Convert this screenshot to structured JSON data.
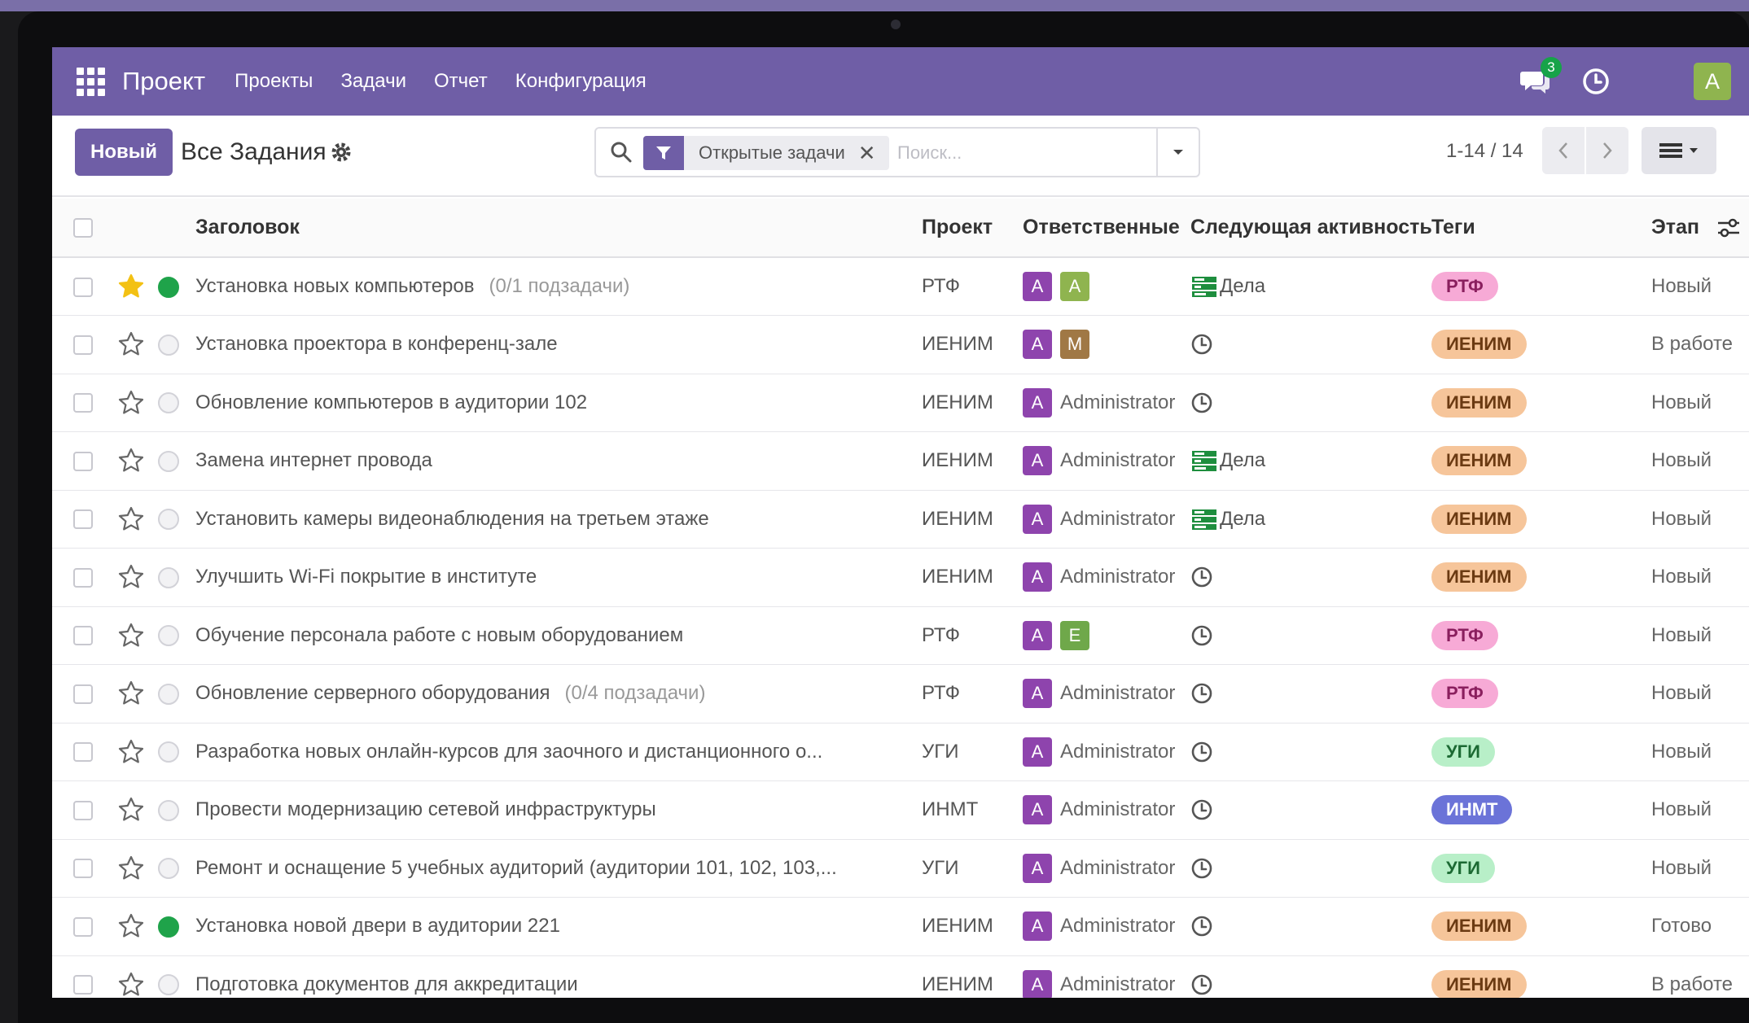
{
  "navbar": {
    "app_name": "Проект",
    "menu": [
      "Проекты",
      "Задачи",
      "Отчет",
      "Конфигурация"
    ],
    "chat_count": "3",
    "user_initial": "A"
  },
  "control": {
    "new_button": "Новый",
    "view_title": "Все Задания",
    "search_facet": "Открытые задачи",
    "search_placeholder": "Поиск...",
    "pager": "1-14 / 14"
  },
  "table": {
    "headers": {
      "title": "Заголовок",
      "project": "Проект",
      "assignees": "Ответственные",
      "activity": "Следующая активность",
      "tags": "Теги",
      "stage": "Этап"
    },
    "rows": [
      {
        "starred": true,
        "done": true,
        "title": "Установка новых компьютеров",
        "subtasks": "(0/1 подзадачи)",
        "project": "РТФ",
        "avatars": [
          {
            "letter": "A",
            "color": "#8e44ad"
          },
          {
            "letter": "A",
            "color": "#8fb44f"
          }
        ],
        "assignee_name": "",
        "activity": "Дела",
        "tag": "РТФ",
        "tag_kind": "rtf",
        "stage": "Новый"
      },
      {
        "starred": false,
        "done": false,
        "title": "Установка проектора в конференц-зале",
        "subtasks": "",
        "project": "ИЕНИМ",
        "avatars": [
          {
            "letter": "A",
            "color": "#8e44ad"
          },
          {
            "letter": "M",
            "color": "#a07845"
          }
        ],
        "assignee_name": "",
        "activity": "",
        "tag": "ИЕНИМ",
        "tag_kind": "ienim",
        "stage": "В работе"
      },
      {
        "starred": false,
        "done": false,
        "title": "Обновление компьютеров в аудитории 102",
        "subtasks": "",
        "project": "ИЕНИМ",
        "avatars": [
          {
            "letter": "A",
            "color": "#8e44ad"
          }
        ],
        "assignee_name": "Administrator",
        "activity": "",
        "tag": "ИЕНИМ",
        "tag_kind": "ienim",
        "stage": "Новый"
      },
      {
        "starred": false,
        "done": false,
        "title": "Замена интернет провода",
        "subtasks": "",
        "project": "ИЕНИМ",
        "avatars": [
          {
            "letter": "A",
            "color": "#8e44ad"
          }
        ],
        "assignee_name": "Administrator",
        "activity": "Дела",
        "tag": "ИЕНИМ",
        "tag_kind": "ienim",
        "stage": "Новый"
      },
      {
        "starred": false,
        "done": false,
        "title": "Установить камеры видеонаблюдения на третьем этаже",
        "subtasks": "",
        "project": "ИЕНИМ",
        "avatars": [
          {
            "letter": "A",
            "color": "#8e44ad"
          }
        ],
        "assignee_name": "Administrator",
        "activity": "Дела",
        "tag": "ИЕНИМ",
        "tag_kind": "ienim",
        "stage": "Новый"
      },
      {
        "starred": false,
        "done": false,
        "title": "Улучшить Wi-Fi покрытие в институте",
        "subtasks": "",
        "project": "ИЕНИМ",
        "avatars": [
          {
            "letter": "A",
            "color": "#8e44ad"
          }
        ],
        "assignee_name": "Administrator",
        "activity": "",
        "tag": "ИЕНИМ",
        "tag_kind": "ienim",
        "stage": "Новый"
      },
      {
        "starred": false,
        "done": false,
        "title": "Обучение персонала работе с новым оборудованием",
        "subtasks": "",
        "project": "РТФ",
        "avatars": [
          {
            "letter": "A",
            "color": "#8e44ad"
          },
          {
            "letter": "E",
            "color": "#6fa84a"
          }
        ],
        "assignee_name": "",
        "activity": "",
        "tag": "РТФ",
        "tag_kind": "rtf",
        "stage": "Новый"
      },
      {
        "starred": false,
        "done": false,
        "title": "Обновление серверного оборудования",
        "subtasks": "(0/4 подзадачи)",
        "project": "РТФ",
        "avatars": [
          {
            "letter": "A",
            "color": "#8e44ad"
          }
        ],
        "assignee_name": "Administrator",
        "activity": "",
        "tag": "РТФ",
        "tag_kind": "rtf",
        "stage": "Новый"
      },
      {
        "starred": false,
        "done": false,
        "title": "Разработка новых онлайн-курсов для заочного и дистанционного о...",
        "subtasks": "",
        "project": "УГИ",
        "avatars": [
          {
            "letter": "A",
            "color": "#8e44ad"
          }
        ],
        "assignee_name": "Administrator",
        "activity": "",
        "tag": "УГИ",
        "tag_kind": "ugi",
        "stage": "Новый"
      },
      {
        "starred": false,
        "done": false,
        "title": "Провести модернизацию сетевой инфраструктуры",
        "subtasks": "",
        "project": "ИНМТ",
        "avatars": [
          {
            "letter": "A",
            "color": "#8e44ad"
          }
        ],
        "assignee_name": "Administrator",
        "activity": "",
        "tag": "ИНМТ",
        "tag_kind": "inmt",
        "stage": "Новый"
      },
      {
        "starred": false,
        "done": false,
        "title": "Ремонт и оснащение 5 учебных аудиторий (аудитории 101, 102, 103,...",
        "subtasks": "",
        "project": "УГИ",
        "avatars": [
          {
            "letter": "A",
            "color": "#8e44ad"
          }
        ],
        "assignee_name": "Administrator",
        "activity": "",
        "tag": "УГИ",
        "tag_kind": "ugi",
        "stage": "Новый"
      },
      {
        "starred": false,
        "done": true,
        "title": "Установка новой двери в аудитории 221",
        "subtasks": "",
        "project": "ИЕНИМ",
        "avatars": [
          {
            "letter": "A",
            "color": "#8e44ad"
          }
        ],
        "assignee_name": "Administrator",
        "activity": "",
        "tag": "ИЕНИМ",
        "tag_kind": "ienim",
        "stage": "Готово"
      },
      {
        "starred": false,
        "done": false,
        "title": "Подготовка документов для аккредитации",
        "subtasks": "",
        "project": "ИЕНИМ",
        "avatars": [
          {
            "letter": "A",
            "color": "#8e44ad"
          }
        ],
        "assignee_name": "Administrator",
        "activity": "",
        "tag": "ИЕНИМ",
        "tag_kind": "ienim",
        "stage": "В работе"
      }
    ]
  },
  "colors": {
    "brand": "#6f5ea6",
    "star_active": "#f3c114",
    "kanban_done": "#1fa34a"
  },
  "icons": [
    "apps-grid-icon",
    "chat-icon",
    "clock-icon",
    "gear-icon",
    "search-icon",
    "filter-icon",
    "close-icon",
    "caret-down-icon",
    "chevron-left-icon",
    "chevron-right-icon",
    "list-view-icon",
    "optional-columns-icon",
    "star-icon",
    "activity-todo-icon",
    "activity-clock-icon"
  ]
}
